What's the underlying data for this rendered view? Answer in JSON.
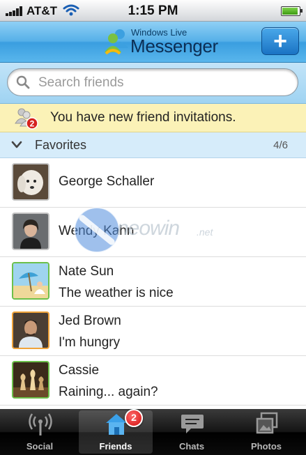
{
  "status_bar": {
    "carrier": "AT&T",
    "time": "1:15 PM"
  },
  "header": {
    "brand_small": "Windows Live",
    "brand_big": "Messenger",
    "add_label": "+"
  },
  "search": {
    "placeholder": "Search friends",
    "value": ""
  },
  "banner": {
    "text": "You have new friend invitations.",
    "badge": "2"
  },
  "favorites": {
    "label": "Favorites",
    "count": "4/6"
  },
  "contacts": [
    {
      "name": "George Schaller",
      "status": ""
    },
    {
      "name": "Wendy Kahn",
      "status": ""
    },
    {
      "name": "Nate Sun",
      "status": "The weather is nice"
    },
    {
      "name": "Jed Brown",
      "status": "I'm hungry"
    },
    {
      "name": "Cassie",
      "status": "Raining... again?"
    }
  ],
  "watermark": {
    "text": "neowin",
    "suffix": ".net"
  },
  "tabs": [
    {
      "label": "Social",
      "icon": "broadcast-icon"
    },
    {
      "label": "Friends",
      "icon": "house-icon",
      "badge": "2",
      "active": true
    },
    {
      "label": "Chats",
      "icon": "chat-bubble-icon"
    },
    {
      "label": "Photos",
      "icon": "photos-icon"
    }
  ],
  "colors": {
    "header_blue": "#3a9ee0",
    "banner_yellow": "#fbf2b7",
    "badge_red": "#d10e0e"
  }
}
